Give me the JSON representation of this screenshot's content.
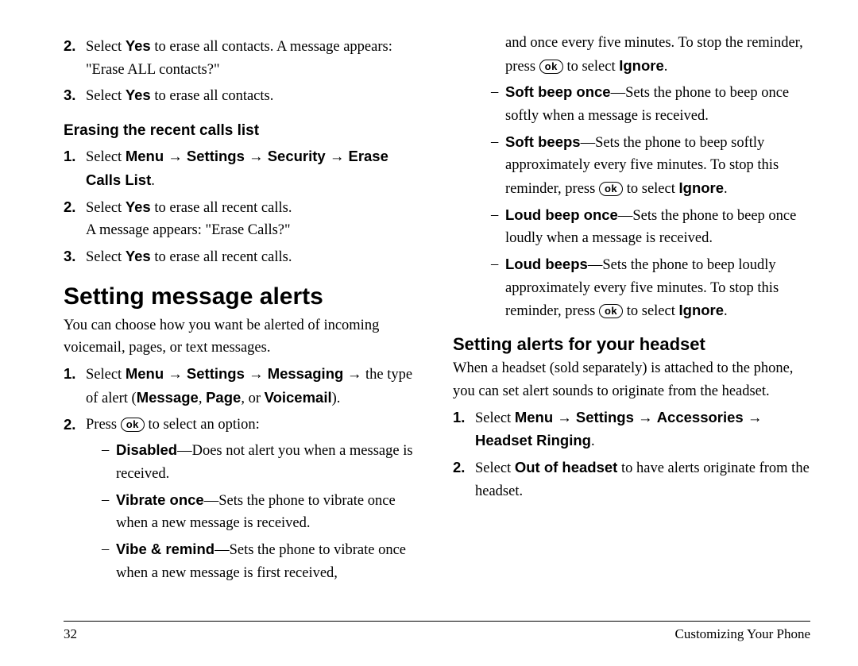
{
  "left": {
    "steps_top": [
      {
        "num": "2.",
        "pre": "Select ",
        "b1": "Yes",
        "post1": " to erase all contacts. A message appears: \"Erase ALL contacts?\""
      },
      {
        "num": "3.",
        "pre": "Select ",
        "b1": "Yes",
        "post1": " to erase all contacts."
      }
    ],
    "h3_erasing": "Erasing the recent calls list",
    "erase_calls": [
      {
        "num": "1.",
        "pre": "Select ",
        "b1": "Menu",
        "a1": " → ",
        "b2": "Settings",
        "a2": " → ",
        "b3": "Security",
        "a3": " → ",
        "b4": "Erase Calls List",
        "post": "."
      },
      {
        "num": "2.",
        "pre": "Select ",
        "b1": "Yes",
        "post1": " to erase all recent calls.",
        "line2": "A message appears: \"Erase Calls?\""
      },
      {
        "num": "3.",
        "pre": "Select ",
        "b1": "Yes",
        "post1": " to erase all recent calls."
      }
    ],
    "h1_alerts": "Setting message alerts",
    "intro": "You can choose how you want be alerted of incoming voicemail, pages, or text messages.",
    "alert_steps": {
      "s1": {
        "num": "1.",
        "pre": "Select ",
        "b1": "Menu",
        "a1": " → ",
        "b2": "Settings",
        "a2": " → ",
        "b3": "Messaging",
        "post1": " → the type of alert (",
        "b4": "Message",
        "c1": ", ",
        "b5": "Page",
        "c2": ", or ",
        "b6": "Voicemail",
        "post2": ")."
      },
      "s2": {
        "num": "2.",
        "pre": "Press ",
        "ok": "ok",
        "post": " to select an option:"
      }
    },
    "options_left": [
      {
        "b": "Disabled",
        "dash": "—",
        "rest": "Does not alert you when a message is received."
      },
      {
        "b": "Vibrate once",
        "dash": "—",
        "rest": "Sets the phone to vibrate once when a new message is received."
      },
      {
        "b": "Vibe & remind",
        "dash": "—",
        "rest": "Sets the phone to vibrate once when a new message is first received,"
      }
    ]
  },
  "right": {
    "cont_top": {
      "t1": "and once every five minutes. To stop the reminder, press ",
      "ok": "ok",
      "t2": " to select ",
      "b1": "Ignore",
      "t3": "."
    },
    "options_right": [
      {
        "b": "Soft beep once",
        "dash": "—",
        "rest": "Sets the phone to beep once softly when a message is received."
      },
      {
        "b": "Soft beeps",
        "dash": "—",
        "r1": "Sets the phone to beep softly approximately every five minutes. To stop this reminder, press ",
        "ok": "ok",
        "r2": " to select ",
        "bi": "Ignore",
        "r3": "."
      },
      {
        "b": "Loud beep once",
        "dash": "—",
        "rest": "Sets the phone to beep once loudly when a message is received."
      },
      {
        "b": "Loud beeps",
        "dash": "—",
        "r1": "Sets the phone to beep loudly approximately every five minutes. To stop this reminder, press ",
        "ok": "ok",
        "r2": " to select ",
        "bi": "Ignore",
        "r3": "."
      }
    ],
    "h2_headset": "Setting alerts for your headset",
    "headset_intro": "When a headset (sold separately) is attached to the phone, you can set alert sounds to originate from the headset.",
    "headset_steps": [
      {
        "num": "1.",
        "pre": "Select ",
        "b1": "Menu",
        "a1": " → ",
        "b2": "Settings",
        "a2": " → ",
        "b3": "Accessories",
        "a3": " → ",
        "b4": "Headset Ringing",
        "post": "."
      },
      {
        "num": "2.",
        "pre": "Select ",
        "b1": "Out of headset",
        "post": " to have alerts originate from the headset."
      }
    ]
  },
  "footer": {
    "page": "32",
    "chapter": "Customizing Your Phone"
  }
}
